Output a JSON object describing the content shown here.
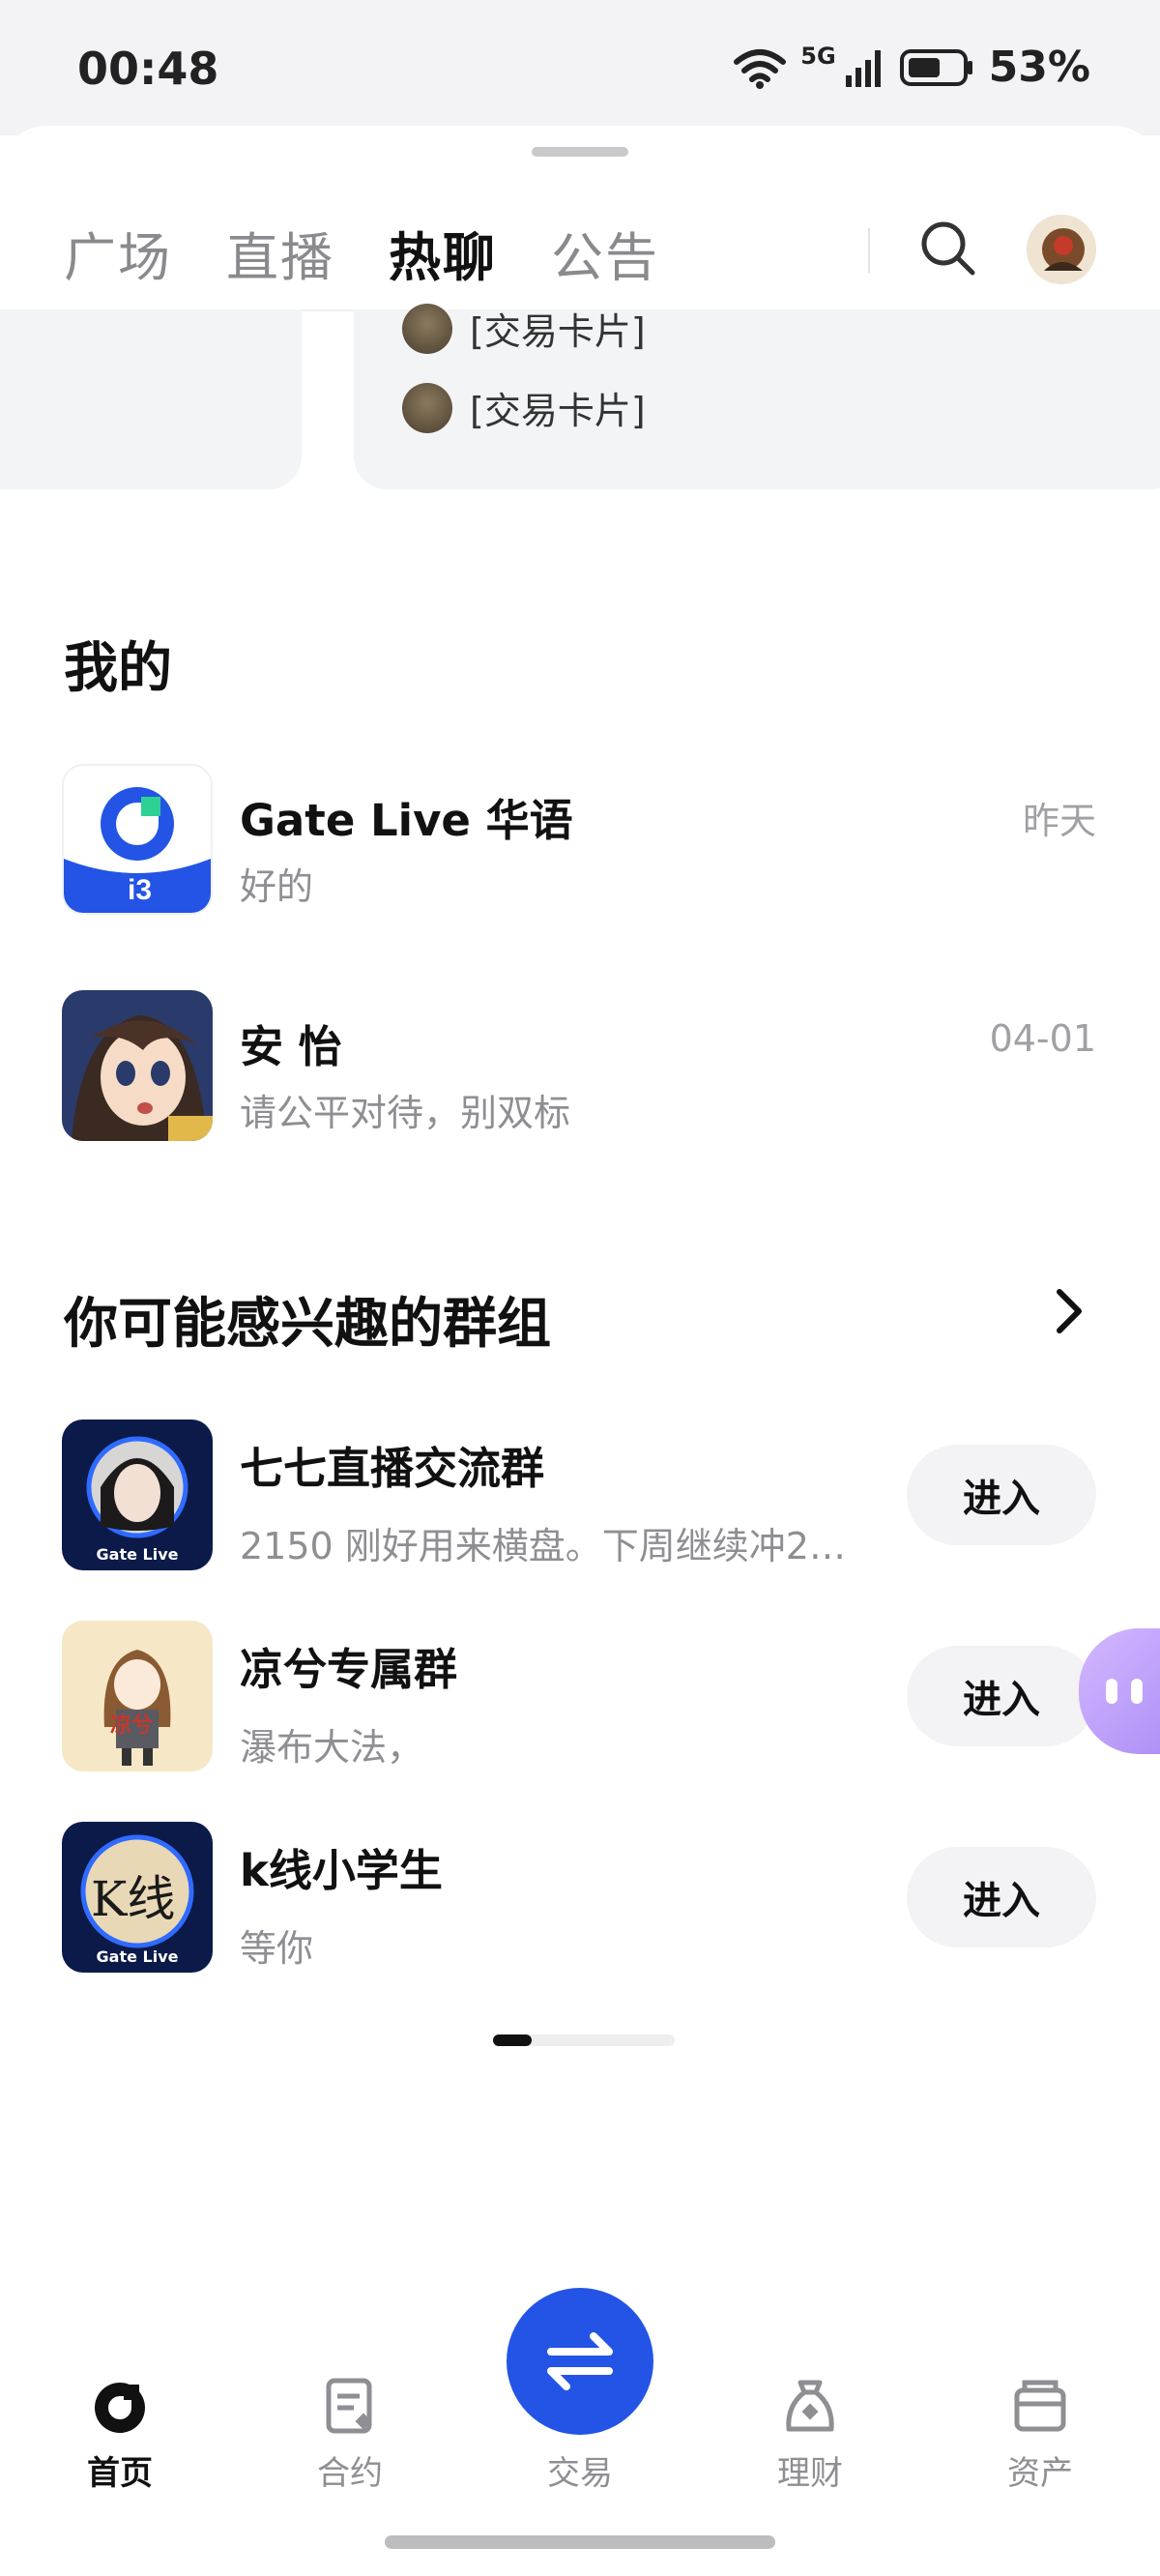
{
  "status_bar": {
    "time": "00:48",
    "network": "5G",
    "battery": "53%"
  },
  "tabs": [
    {
      "label": "广场",
      "active": false
    },
    {
      "label": "直播",
      "active": false
    },
    {
      "label": "热聊",
      "active": true
    },
    {
      "label": "公告",
      "active": false
    }
  ],
  "preview_cards": {
    "items": [
      "[交易卡片]",
      "[交易卡片]"
    ]
  },
  "mine": {
    "title": "我的",
    "chats": [
      {
        "name": "Gate Live 华语",
        "last_message": "好的",
        "time": "昨天"
      },
      {
        "name": "安 怡",
        "last_message": "请公平对待，别双标",
        "time": "04-01"
      }
    ]
  },
  "groups": {
    "title": "你可能感兴趣的群组",
    "join_label": "进入",
    "items": [
      {
        "name": "七七直播交流群",
        "last_message": "2150 刚好用来横盘。下周继续冲23..."
      },
      {
        "name": "凉兮专属群",
        "last_message": "瀑布大法，"
      },
      {
        "name": "k线小学生",
        "last_message": "等你"
      }
    ]
  },
  "avatar_text": {
    "gate_live": "Gate Live",
    "liangxi": "凉兮",
    "kline": "K线"
  },
  "bottom_nav": [
    {
      "label": "首页",
      "active": true
    },
    {
      "label": "合约",
      "active": false
    },
    {
      "label": "交易",
      "active": false
    },
    {
      "label": "理财",
      "active": false
    },
    {
      "label": "资产",
      "active": false
    }
  ],
  "colors": {
    "accent": "#2354e6",
    "muted": "#8e8e93",
    "surface": "#f3f4f6"
  }
}
